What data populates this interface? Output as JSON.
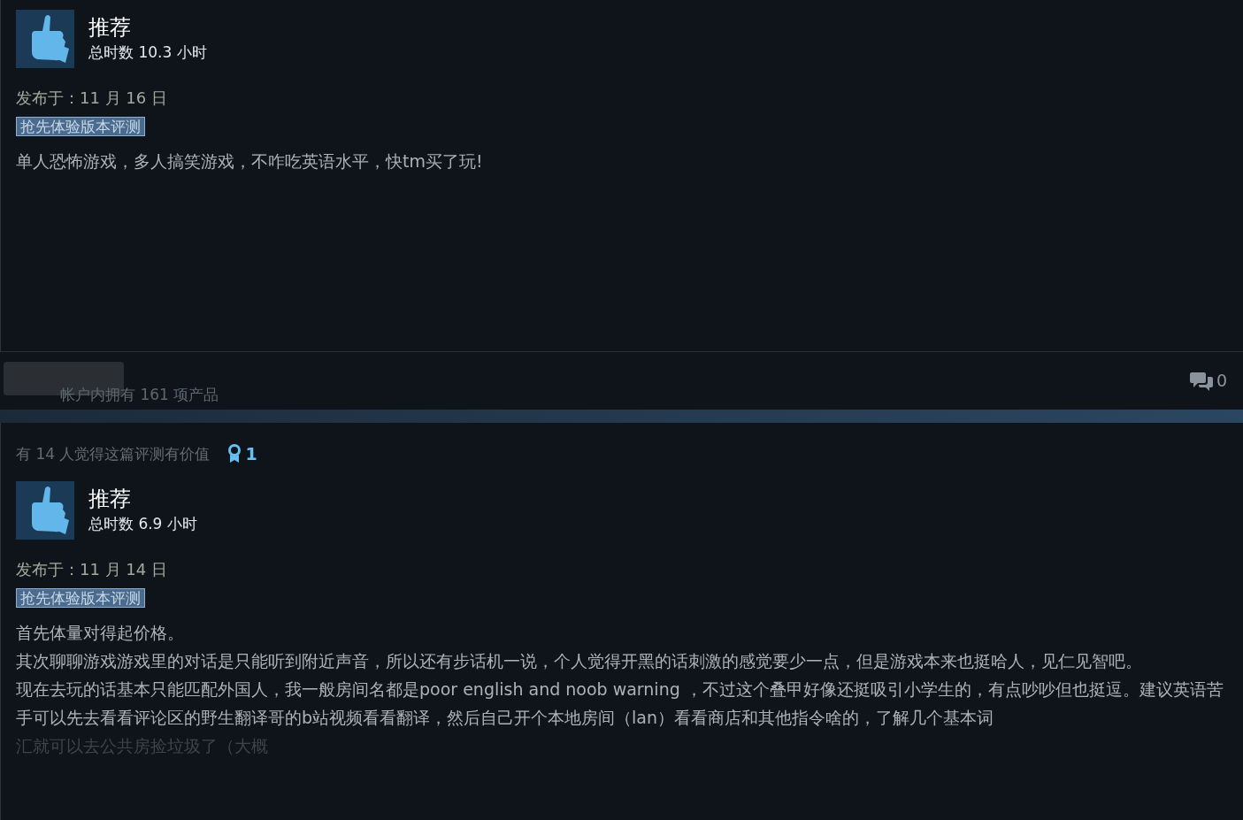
{
  "reviews": [
    {
      "verdict": "推荐",
      "hours": "总时数 10.3 小时",
      "posted": "发布于：11 月 16 日",
      "tag": "抢先体验版本评测",
      "paragraphs": [
        "单人恐怖游戏，多人搞笑游戏，不咋吃英语水平，快tm买了玩!"
      ],
      "products": "帐户内拥有 161 项产品",
      "comments": "0"
    },
    {
      "helpful": "有 14 人觉得这篇评测有价值",
      "awards": "1",
      "verdict": "推荐",
      "hours": "总时数 6.9 小时",
      "posted": "发布于：11 月 14 日",
      "tag": "抢先体验版本评测",
      "paragraphs": [
        "首先体量对得起价格。",
        "其次聊聊游戏游戏里的对话是只能听到附近声音，所以还有步话机一说，个人觉得开黑的话刺激的感觉要少一点，但是游戏本来也挺哈人，见仁见智吧。",
        "现在去玩的话基本只能匹配外国人，我一般房间名都是poor english and noob warning ，不过这个叠甲好像还挺吸引小学生的，有点吵吵但也挺逗。建议英语苦手可以先去看看评论区的野生翻译哥的b站视频看看翻译，然后自己开个本地房间（lan）看看商店和其他指令啥的，了解几个基本词"
      ],
      "fade_tail": "汇就可以去公共房捡垃圾了（大概"
    }
  ]
}
